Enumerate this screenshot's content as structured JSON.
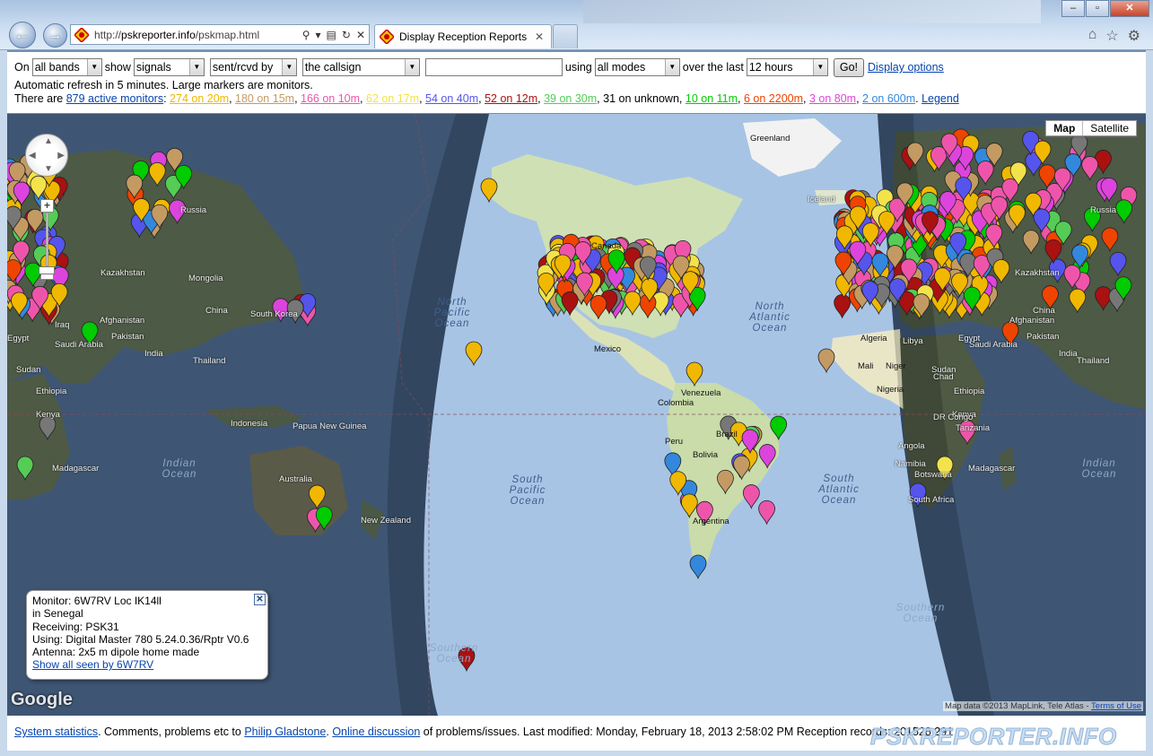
{
  "browser": {
    "url_prefix": "http://",
    "url_host": "pskreporter.info",
    "url_path": "/pskmap.html",
    "tab_title": "Display Reception Reports"
  },
  "controls": {
    "on_label": "On",
    "band": "all bands",
    "show_label": "show",
    "what": "signals",
    "direction": "sent/rcvd by",
    "who": "the callsign",
    "callsign_value": "",
    "using_label": "using",
    "mode": "all modes",
    "over_label": "over the last",
    "period": "12 hours",
    "go": "Go!",
    "display_options": "Display options",
    "refresh_note": "Automatic refresh in 5 minutes. Large markers are monitors.",
    "there_are": "There are",
    "active_monitors": "879 active monitors",
    "legend": "Legend",
    "bands": [
      {
        "text": "274 on 20m",
        "color": "#f0b800"
      },
      {
        "text": "180 on 15m",
        "color": "#c49a63"
      },
      {
        "text": "166 on 10m",
        "color": "#ee55aa"
      },
      {
        "text": "62 on 17m",
        "color": "#f2e24c"
      },
      {
        "text": "54 on 40m",
        "color": "#5555ee"
      },
      {
        "text": "52 on 12m",
        "color": "#aa1111"
      },
      {
        "text": "39 on 30m",
        "color": "#55cc55"
      },
      {
        "text": "31 on unknown",
        "color": "#000000"
      },
      {
        "text": "10 on 11m",
        "color": "#00cc00"
      },
      {
        "text": "6 on 2200m",
        "color": "#ee4400"
      },
      {
        "text": "3 on 80m",
        "color": "#dd44dd"
      },
      {
        "text": "2 on 600m",
        "color": "#3388dd"
      }
    ]
  },
  "map": {
    "type_map": "Map",
    "type_satellite": "Satellite",
    "google": "Google",
    "credit": "Map data ©2013 MapLink, Tele Atlas - ",
    "terms": "Terms of Use",
    "labels": [
      "Greenland",
      "Iceland",
      "Russia",
      "Russia",
      "Kazakhstan",
      "Kazakhstan",
      "Mongolia",
      "China",
      "China",
      "South Korea",
      "Afghanistan",
      "Afghanistan",
      "Pakistan",
      "Pakistan",
      "India",
      "India",
      "Saudi Arabia",
      "Saudi Arabia",
      "Iraq",
      "Egypt",
      "Egypt",
      "Sudan",
      "Sudan",
      "Ethiopia",
      "Ethiopia",
      "Kenya",
      "Kenya",
      "Tanzania",
      "Madagascar",
      "Madagascar",
      "Thailand",
      "Thailand",
      "Indonesia",
      "Papua New Guinea",
      "Australia",
      "New Zealand",
      "Canada",
      "Mexico",
      "Venezuela",
      "Colombia",
      "Peru",
      "Brazil",
      "Bolivia",
      "Argentina",
      "Algeria",
      "Libya",
      "Mali",
      "Niger",
      "Chad",
      "Nigeria",
      "DR Congo",
      "Angola",
      "Namibia",
      "Botswana",
      "South Africa"
    ],
    "oceans": [
      "North Pacific Ocean",
      "North Atlantic Ocean",
      "South Pacific Ocean",
      "South Atlantic Ocean",
      "Indian Ocean",
      "Indian Ocean",
      "Southern Ocean",
      "Southern Ocean"
    ]
  },
  "info": {
    "monitor": "Monitor: 6W7RV Loc IK14ll",
    "country": "in Senegal",
    "receiving": "Receiving: PSK31",
    "using": "Using: Digital Master 780 5.24.0.36/Rptr V0.6",
    "antenna": "Antenna: 2x5 m dipole home made",
    "show_all": "Show all seen by 6W7RV"
  },
  "footer": {
    "stats": "System statistics",
    "text1": ". Comments, problems etc to ",
    "person": "Philip Gladstone",
    "text2": ". ",
    "discussion": "Online discussion",
    "text3": " of problems/issues. Last modified: Monday, February 18, 2013 2:58:02 PM Reception records: 201528 291"
  },
  "brand": "PSKREPORTER.INFO",
  "colors": {
    "link": "#0645ad",
    "land_night": "#4a5a4a",
    "land_day": "#e9e6c8",
    "ocean_day": "#a8c4e4",
    "ocean_night": "#3e5674"
  }
}
